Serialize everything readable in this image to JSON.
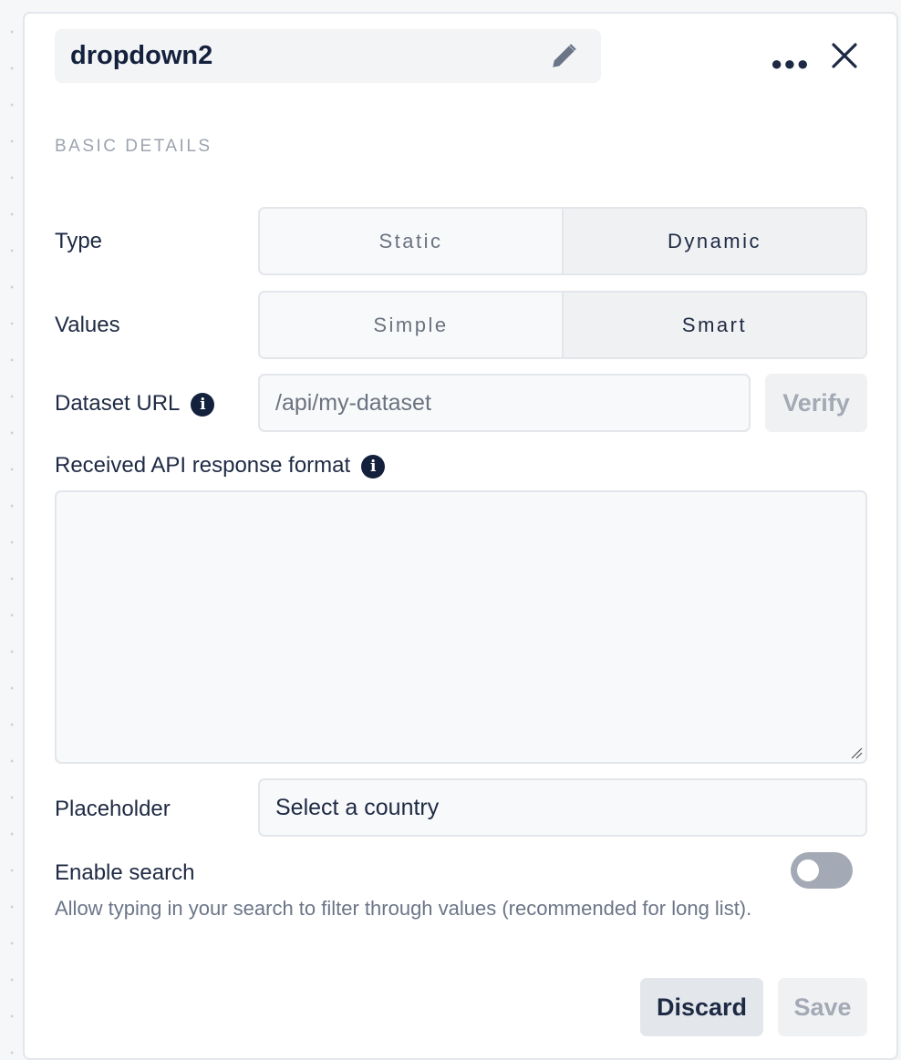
{
  "header": {
    "title": "dropdown2",
    "edit_icon": "pencil-icon",
    "more_icon": "more-horizontal-icon",
    "close_icon": "close-icon"
  },
  "section_title": "BASIC DETAILS",
  "type": {
    "label": "Type",
    "options": [
      "Static",
      "Dynamic"
    ],
    "selected": "Dynamic"
  },
  "values": {
    "label": "Values",
    "options": [
      "Simple",
      "Smart"
    ],
    "selected": "Smart"
  },
  "dataset_url": {
    "label": "Dataset URL",
    "placeholder": "/api/my-dataset",
    "value": "",
    "verify_label": "Verify"
  },
  "response_format": {
    "label": "Received API response format",
    "value": ""
  },
  "placeholder": {
    "label": "Placeholder",
    "value": "Select a country"
  },
  "enable_search": {
    "label": "Enable search",
    "description": "Allow typing in your search to filter through values (recommended for long list).",
    "enabled": false
  },
  "footer": {
    "discard_label": "Discard",
    "save_label": "Save"
  }
}
